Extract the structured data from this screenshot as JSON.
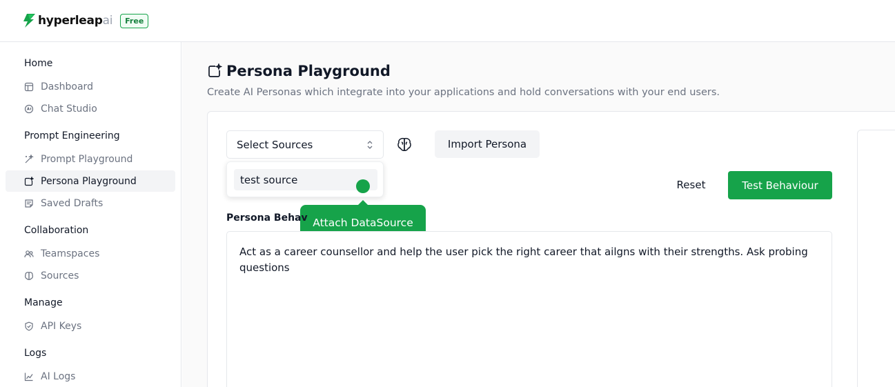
{
  "brand": {
    "name": "hyperleap",
    "suffix": "ai",
    "plan": "Free",
    "accent": "#16a34a"
  },
  "sidebar": {
    "sections": [
      {
        "title": "Home",
        "items": [
          {
            "label": "Dashboard",
            "icon": "dashboard-icon"
          },
          {
            "label": "Chat Studio",
            "icon": "chat-icon"
          }
        ]
      },
      {
        "title": "Prompt Engineering",
        "items": [
          {
            "label": "Prompt Playground",
            "icon": "wand-icon"
          },
          {
            "label": "Persona Playground",
            "icon": "persona-icon",
            "active": true
          },
          {
            "label": "Saved Drafts",
            "icon": "drafts-icon"
          }
        ]
      },
      {
        "title": "Collaboration",
        "items": [
          {
            "label": "Teamspaces",
            "icon": "users-icon"
          },
          {
            "label": "Sources",
            "icon": "brain-icon"
          }
        ]
      },
      {
        "title": "Manage",
        "items": [
          {
            "label": "API Keys",
            "icon": "shield-icon"
          }
        ]
      },
      {
        "title": "Logs",
        "items": [
          {
            "label": "AI Logs",
            "icon": "chart-icon"
          }
        ]
      }
    ]
  },
  "page": {
    "title": "Persona Playground",
    "subtitle": "Create AI Personas which integrate into your applications and hold conversations with your end users."
  },
  "toolbar": {
    "select_sources": "Select Sources",
    "import_persona": "Import Persona",
    "reset": "Reset",
    "test_behaviour": "Test Behaviour"
  },
  "dropdown": {
    "options": [
      "test source"
    ]
  },
  "tooltip": {
    "text": "Attach DataSource"
  },
  "persona": {
    "label": "Persona Behav",
    "behaviour": "Act as a career counsellor and help the user pick the right career that ailgns with their strengths. Ask probing questions"
  }
}
